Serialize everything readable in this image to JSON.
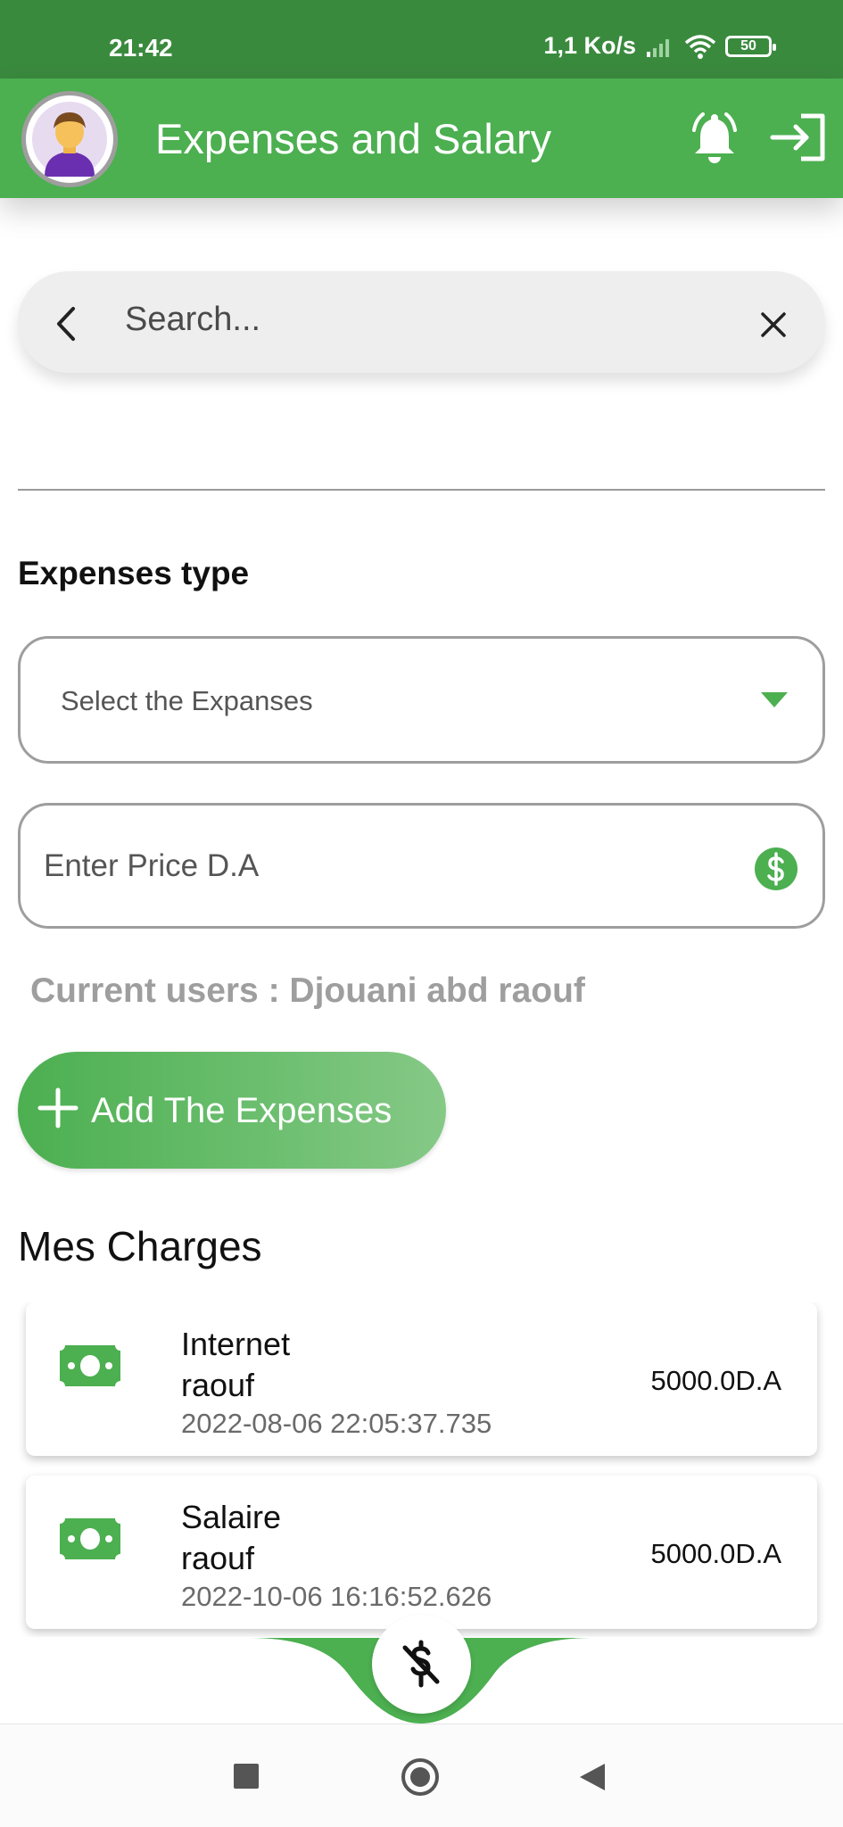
{
  "status_bar": {
    "time": "21:42",
    "network_speed": "1,1 Ko/s",
    "battery": "50"
  },
  "app_bar": {
    "title": "Expenses and Salary"
  },
  "search": {
    "placeholder": "Search..."
  },
  "form": {
    "section_label": "Expenses type",
    "dropdown_placeholder": "Select the Expanses",
    "price_placeholder": "Enter Price D.A",
    "current_users": "Current users : Djouani abd raouf",
    "add_button_label": "Add The Expenses"
  },
  "charges": {
    "title": "Mes Charges",
    "items": [
      {
        "title": "Internet",
        "user": "raouf",
        "date": "2022-08-06 22:05:37.735",
        "amount": "5000.0D.A"
      },
      {
        "title": "Salaire",
        "user": "raouf",
        "date": "2022-10-06 16:16:52.626",
        "amount": "5000.0D.A"
      }
    ]
  },
  "colors": {
    "primary": "#4caf50",
    "status_bar": "#3a8a3e"
  }
}
